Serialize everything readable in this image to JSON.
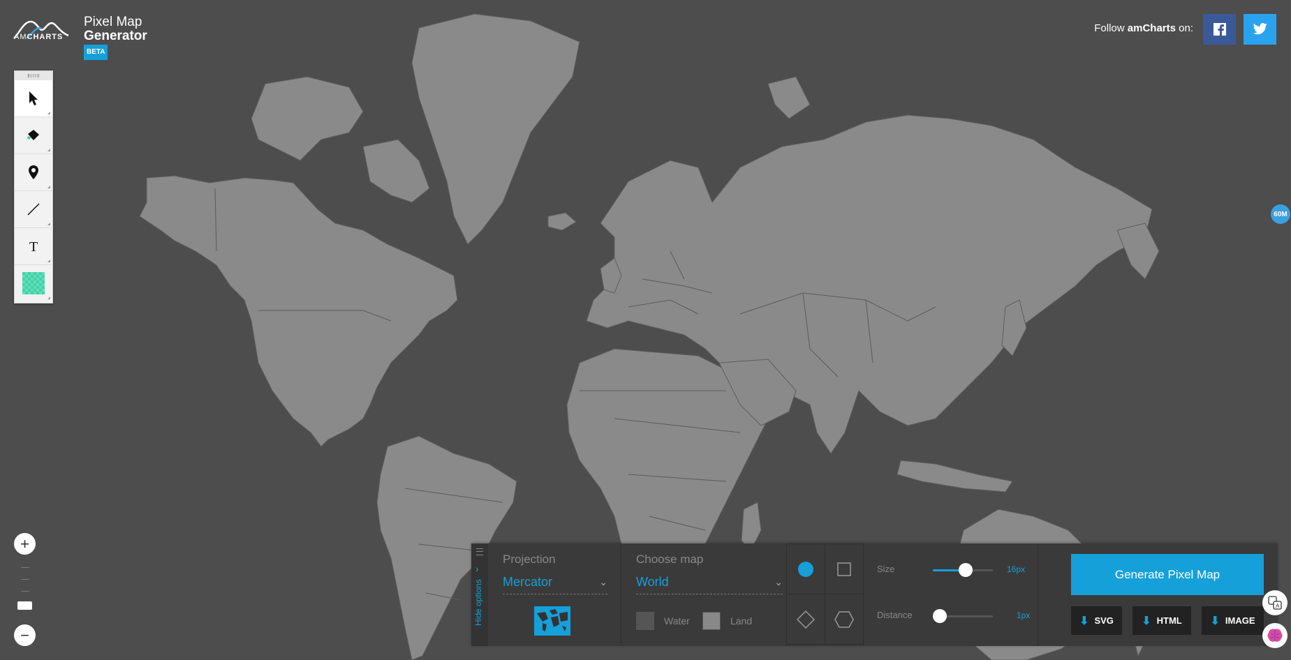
{
  "app": {
    "logo_text_light": "AM",
    "logo_text_bold": "CHARTS",
    "title_line1": "Pixel Map",
    "title_line2": "Generator",
    "badge": "BETA"
  },
  "header": {
    "follow_prefix": "Follow ",
    "follow_brand": "amCharts",
    "follow_suffix": " on:",
    "social": [
      {
        "name": "facebook-icon",
        "color": "#3b5998"
      },
      {
        "name": "twitter-icon",
        "color": "#2aa3ef"
      }
    ]
  },
  "toolbar": {
    "tools": [
      {
        "name": "select-tool",
        "icon": "cursor-icon",
        "active": true
      },
      {
        "name": "fill-tool",
        "icon": "paint-bucket-icon"
      },
      {
        "name": "marker-tool",
        "icon": "map-pin-icon"
      },
      {
        "name": "line-tool",
        "icon": "line-icon"
      },
      {
        "name": "text-tool",
        "icon": "text-icon"
      },
      {
        "name": "color-swatch",
        "icon": "pattern-swatch-icon",
        "color": "#45d0a8"
      }
    ]
  },
  "zoom": {
    "plus": "+",
    "minus": "−",
    "level_fraction": 0.2
  },
  "scale_badge": "60M",
  "options": {
    "hide_label": "Hide options",
    "projection_label": "Projection",
    "projection_value": "Mercator",
    "map_label": "Choose map",
    "map_value": "World",
    "water_label": "Water",
    "land_label": "Land",
    "shape_selected": "circle",
    "size_label": "Size",
    "size_value": "16px",
    "size_fraction": 0.55,
    "distance_label": "Distance",
    "distance_value": "1px",
    "distance_fraction": 0.0,
    "generate_label": "Generate Pixel Map",
    "downloads": [
      "SVG",
      "HTML",
      "IMAGE"
    ]
  },
  "colors": {
    "accent": "#15a0d9",
    "background": "#4d4d4d",
    "land": "#8a8a8a"
  }
}
